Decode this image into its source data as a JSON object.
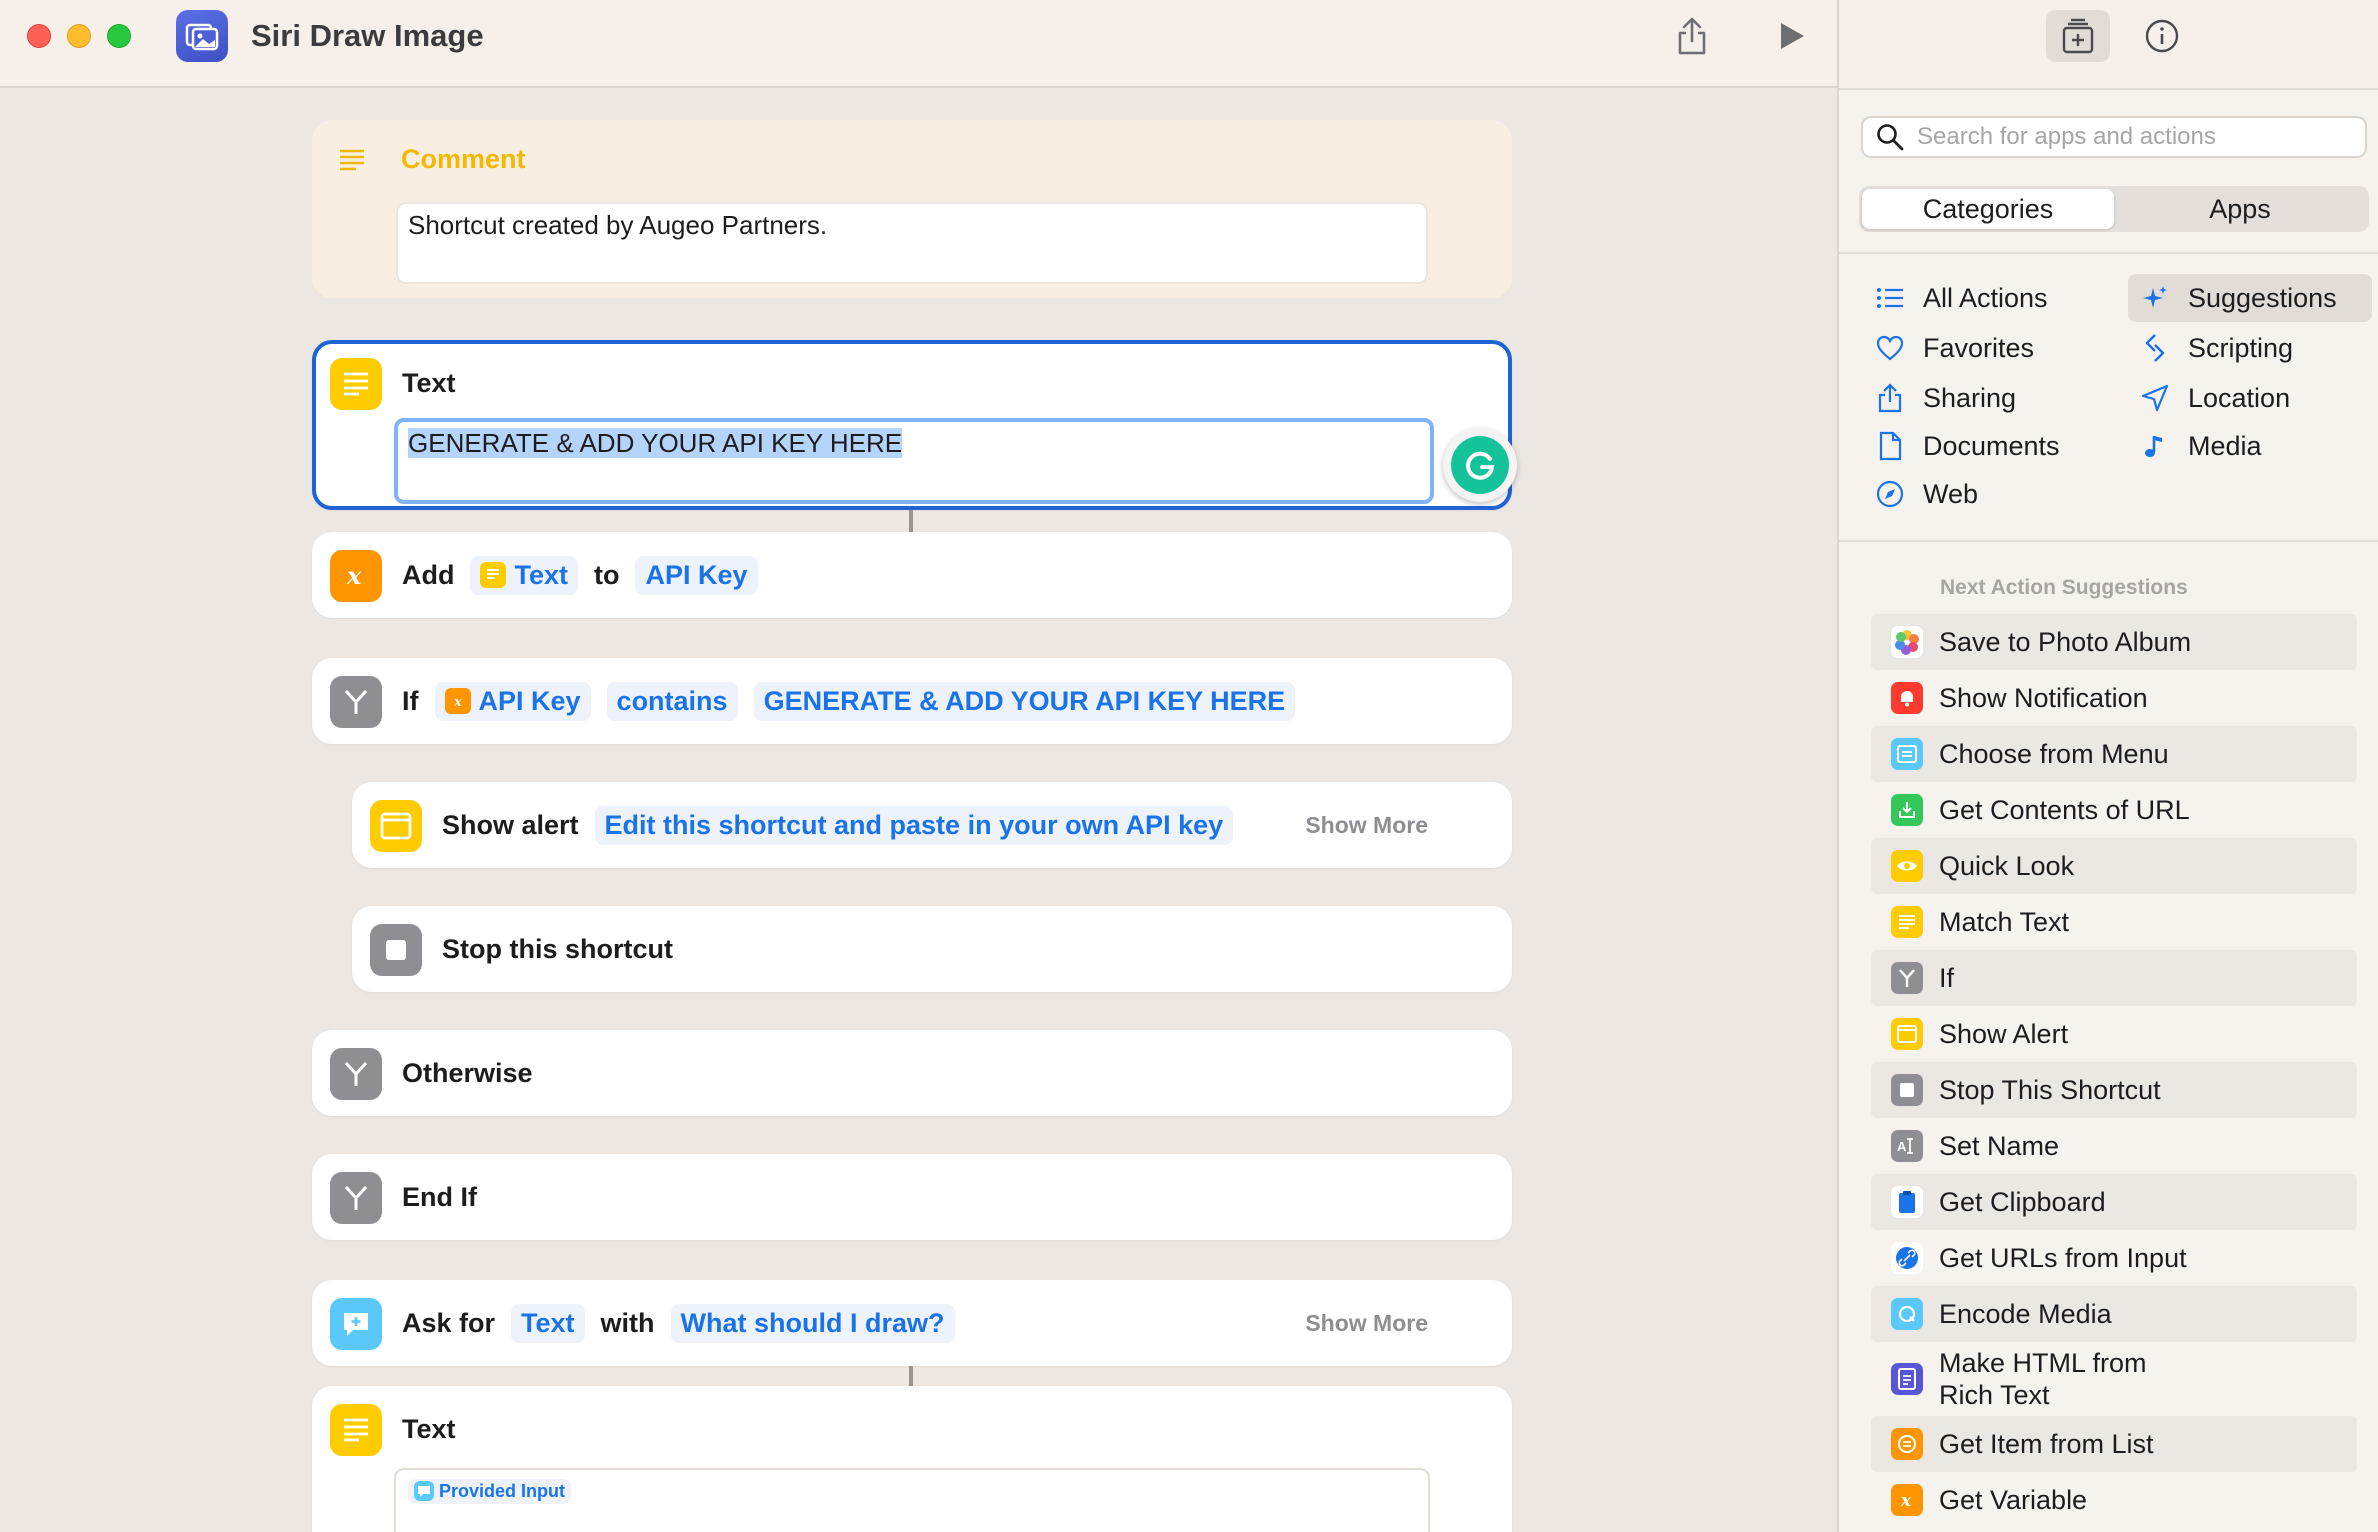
{
  "window": {
    "title": "Siri Draw Image"
  },
  "sidebar": {
    "search_placeholder": "Search for apps and actions",
    "segments": [
      "Categories",
      "Apps"
    ],
    "categories_left": [
      "All Actions",
      "Favorites",
      "Sharing",
      "Documents",
      "Web"
    ],
    "categories_right": [
      "Suggestions",
      "Scripting",
      "Location",
      "Media"
    ],
    "suggestions_heading": "Next Action Suggestions",
    "suggestions": [
      "Save to Photo Album",
      "Show Notification",
      "Choose from Menu",
      "Get Contents of URL",
      "Quick Look",
      "Match Text",
      "If",
      "Show Alert",
      "Stop This Shortcut",
      "Set Name",
      "Get Clipboard",
      "Get URLs from Input",
      "Encode Media",
      "Make HTML from Rich Text",
      "Get Item from List",
      "Get Variable"
    ]
  },
  "actions": {
    "comment": {
      "title": "Comment",
      "body": "Shortcut created by Augeo Partners."
    },
    "text1": {
      "title": "Text",
      "value": "GENERATE & ADD YOUR API KEY HERE"
    },
    "add": {
      "verb": "Add",
      "token1": "Text",
      "prep": "to",
      "token2": "API Key"
    },
    "if": {
      "verb": "If",
      "token1": "API Key",
      "token2": "contains",
      "token3": "GENERATE & ADD YOUR API KEY HERE"
    },
    "alert": {
      "verb": "Show alert",
      "token1": "Edit this shortcut and paste in your own API key",
      "more": "Show More"
    },
    "stop": {
      "label": "Stop this shortcut"
    },
    "otherwise": {
      "label": "Otherwise"
    },
    "endif": {
      "label": "End If"
    },
    "ask": {
      "verb": "Ask for",
      "token1": "Text",
      "prep": "with",
      "token2": "What should I draw?",
      "more": "Show More"
    },
    "text2": {
      "title": "Text",
      "token1": "Provided Input"
    }
  }
}
